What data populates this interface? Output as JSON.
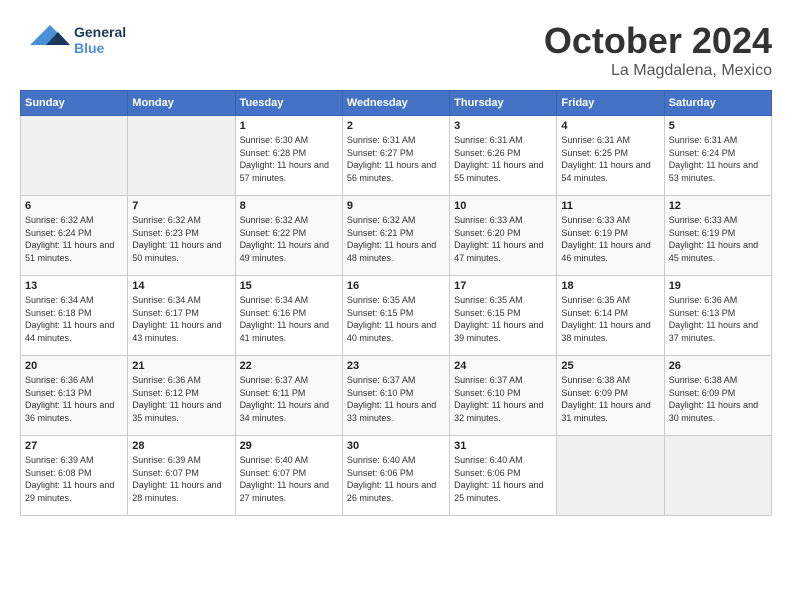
{
  "header": {
    "logo": {
      "general": "General",
      "blue": "Blue"
    },
    "title": "October 2024",
    "location": "La Magdalena, Mexico"
  },
  "calendar": {
    "days_of_week": [
      "Sunday",
      "Monday",
      "Tuesday",
      "Wednesday",
      "Thursday",
      "Friday",
      "Saturday"
    ],
    "weeks": [
      [
        {
          "num": "",
          "sunrise": "",
          "sunset": "",
          "daylight": "",
          "empty": true
        },
        {
          "num": "",
          "sunrise": "",
          "sunset": "",
          "daylight": "",
          "empty": true
        },
        {
          "num": "1",
          "sunrise": "Sunrise: 6:30 AM",
          "sunset": "Sunset: 6:28 PM",
          "daylight": "Daylight: 11 hours and 57 minutes.",
          "empty": false
        },
        {
          "num": "2",
          "sunrise": "Sunrise: 6:31 AM",
          "sunset": "Sunset: 6:27 PM",
          "daylight": "Daylight: 11 hours and 56 minutes.",
          "empty": false
        },
        {
          "num": "3",
          "sunrise": "Sunrise: 6:31 AM",
          "sunset": "Sunset: 6:26 PM",
          "daylight": "Daylight: 11 hours and 55 minutes.",
          "empty": false
        },
        {
          "num": "4",
          "sunrise": "Sunrise: 6:31 AM",
          "sunset": "Sunset: 6:25 PM",
          "daylight": "Daylight: 11 hours and 54 minutes.",
          "empty": false
        },
        {
          "num": "5",
          "sunrise": "Sunrise: 6:31 AM",
          "sunset": "Sunset: 6:24 PM",
          "daylight": "Daylight: 11 hours and 53 minutes.",
          "empty": false
        }
      ],
      [
        {
          "num": "6",
          "sunrise": "Sunrise: 6:32 AM",
          "sunset": "Sunset: 6:24 PM",
          "daylight": "Daylight: 11 hours and 51 minutes.",
          "empty": false
        },
        {
          "num": "7",
          "sunrise": "Sunrise: 6:32 AM",
          "sunset": "Sunset: 6:23 PM",
          "daylight": "Daylight: 11 hours and 50 minutes.",
          "empty": false
        },
        {
          "num": "8",
          "sunrise": "Sunrise: 6:32 AM",
          "sunset": "Sunset: 6:22 PM",
          "daylight": "Daylight: 11 hours and 49 minutes.",
          "empty": false
        },
        {
          "num": "9",
          "sunrise": "Sunrise: 6:32 AM",
          "sunset": "Sunset: 6:21 PM",
          "daylight": "Daylight: 11 hours and 48 minutes.",
          "empty": false
        },
        {
          "num": "10",
          "sunrise": "Sunrise: 6:33 AM",
          "sunset": "Sunset: 6:20 PM",
          "daylight": "Daylight: 11 hours and 47 minutes.",
          "empty": false
        },
        {
          "num": "11",
          "sunrise": "Sunrise: 6:33 AM",
          "sunset": "Sunset: 6:19 PM",
          "daylight": "Daylight: 11 hours and 46 minutes.",
          "empty": false
        },
        {
          "num": "12",
          "sunrise": "Sunrise: 6:33 AM",
          "sunset": "Sunset: 6:19 PM",
          "daylight": "Daylight: 11 hours and 45 minutes.",
          "empty": false
        }
      ],
      [
        {
          "num": "13",
          "sunrise": "Sunrise: 6:34 AM",
          "sunset": "Sunset: 6:18 PM",
          "daylight": "Daylight: 11 hours and 44 minutes.",
          "empty": false
        },
        {
          "num": "14",
          "sunrise": "Sunrise: 6:34 AM",
          "sunset": "Sunset: 6:17 PM",
          "daylight": "Daylight: 11 hours and 43 minutes.",
          "empty": false
        },
        {
          "num": "15",
          "sunrise": "Sunrise: 6:34 AM",
          "sunset": "Sunset: 6:16 PM",
          "daylight": "Daylight: 11 hours and 41 minutes.",
          "empty": false
        },
        {
          "num": "16",
          "sunrise": "Sunrise: 6:35 AM",
          "sunset": "Sunset: 6:15 PM",
          "daylight": "Daylight: 11 hours and 40 minutes.",
          "empty": false
        },
        {
          "num": "17",
          "sunrise": "Sunrise: 6:35 AM",
          "sunset": "Sunset: 6:15 PM",
          "daylight": "Daylight: 11 hours and 39 minutes.",
          "empty": false
        },
        {
          "num": "18",
          "sunrise": "Sunrise: 6:35 AM",
          "sunset": "Sunset: 6:14 PM",
          "daylight": "Daylight: 11 hours and 38 minutes.",
          "empty": false
        },
        {
          "num": "19",
          "sunrise": "Sunrise: 6:36 AM",
          "sunset": "Sunset: 6:13 PM",
          "daylight": "Daylight: 11 hours and 37 minutes.",
          "empty": false
        }
      ],
      [
        {
          "num": "20",
          "sunrise": "Sunrise: 6:36 AM",
          "sunset": "Sunset: 6:13 PM",
          "daylight": "Daylight: 11 hours and 36 minutes.",
          "empty": false
        },
        {
          "num": "21",
          "sunrise": "Sunrise: 6:36 AM",
          "sunset": "Sunset: 6:12 PM",
          "daylight": "Daylight: 11 hours and 35 minutes.",
          "empty": false
        },
        {
          "num": "22",
          "sunrise": "Sunrise: 6:37 AM",
          "sunset": "Sunset: 6:11 PM",
          "daylight": "Daylight: 11 hours and 34 minutes.",
          "empty": false
        },
        {
          "num": "23",
          "sunrise": "Sunrise: 6:37 AM",
          "sunset": "Sunset: 6:10 PM",
          "daylight": "Daylight: 11 hours and 33 minutes.",
          "empty": false
        },
        {
          "num": "24",
          "sunrise": "Sunrise: 6:37 AM",
          "sunset": "Sunset: 6:10 PM",
          "daylight": "Daylight: 11 hours and 32 minutes.",
          "empty": false
        },
        {
          "num": "25",
          "sunrise": "Sunrise: 6:38 AM",
          "sunset": "Sunset: 6:09 PM",
          "daylight": "Daylight: 11 hours and 31 minutes.",
          "empty": false
        },
        {
          "num": "26",
          "sunrise": "Sunrise: 6:38 AM",
          "sunset": "Sunset: 6:09 PM",
          "daylight": "Daylight: 11 hours and 30 minutes.",
          "empty": false
        }
      ],
      [
        {
          "num": "27",
          "sunrise": "Sunrise: 6:39 AM",
          "sunset": "Sunset: 6:08 PM",
          "daylight": "Daylight: 11 hours and 29 minutes.",
          "empty": false
        },
        {
          "num": "28",
          "sunrise": "Sunrise: 6:39 AM",
          "sunset": "Sunset: 6:07 PM",
          "daylight": "Daylight: 11 hours and 28 minutes.",
          "empty": false
        },
        {
          "num": "29",
          "sunrise": "Sunrise: 6:40 AM",
          "sunset": "Sunset: 6:07 PM",
          "daylight": "Daylight: 11 hours and 27 minutes.",
          "empty": false
        },
        {
          "num": "30",
          "sunrise": "Sunrise: 6:40 AM",
          "sunset": "Sunset: 6:06 PM",
          "daylight": "Daylight: 11 hours and 26 minutes.",
          "empty": false
        },
        {
          "num": "31",
          "sunrise": "Sunrise: 6:40 AM",
          "sunset": "Sunset: 6:06 PM",
          "daylight": "Daylight: 11 hours and 25 minutes.",
          "empty": false
        },
        {
          "num": "",
          "sunrise": "",
          "sunset": "",
          "daylight": "",
          "empty": true
        },
        {
          "num": "",
          "sunrise": "",
          "sunset": "",
          "daylight": "",
          "empty": true
        }
      ]
    ]
  }
}
